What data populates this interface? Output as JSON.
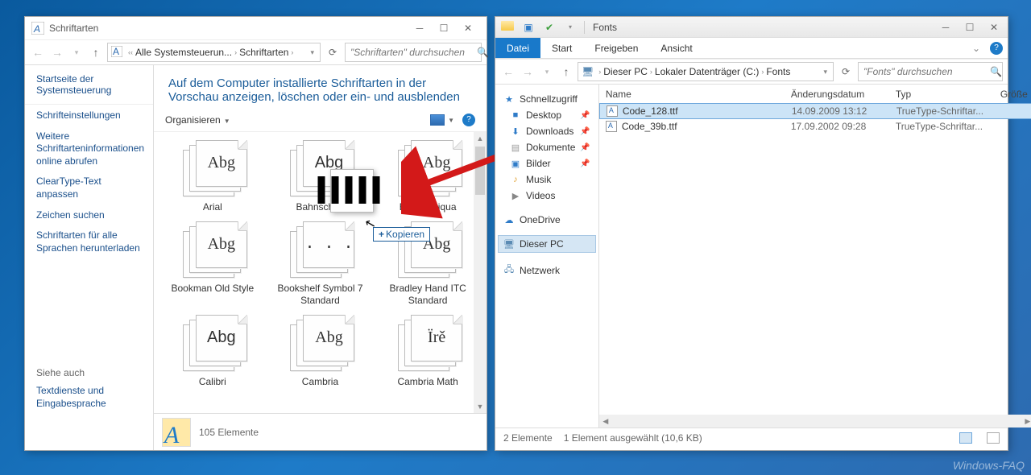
{
  "w1": {
    "title": "Schriftarten",
    "breadcrumb": {
      "seg1": "Alle Systemsteuerun...",
      "seg2": "Schriftarten"
    },
    "search_ph": "\"Schriftarten\" durchsuchen",
    "sidebar": {
      "header": "Startseite der Systemsteuerung",
      "links": [
        "Schrifteinstellungen",
        "Weitere Schriftarteninformationen online abrufen",
        "ClearType-Text anpassen",
        "Zeichen suchen",
        "Schriftarten für alle Sprachen herunterladen"
      ],
      "see_also": "Siehe auch",
      "see_link": "Textdienste und Eingabesprache"
    },
    "heading": "Auf dem Computer installierte Schriftarten in der Vorschau anzeigen, löschen oder ein- und ausblenden",
    "organize": "Organisieren",
    "fonts": [
      [
        "Arial",
        "Abg",
        "serif"
      ],
      [
        "Bahnschrift",
        "Abg",
        "sans"
      ],
      [
        "Book Antiqua",
        "Abg",
        "serif"
      ],
      [
        "Bookman Old Style",
        "Abg",
        "serif"
      ],
      [
        "Bookshelf Symbol 7 Standard",
        ". . .",
        "sym"
      ],
      [
        "Bradley Hand ITC Standard",
        "Abg",
        "cursive"
      ],
      [
        "Calibri",
        "Abg",
        "sans"
      ],
      [
        "Cambria",
        "Abg",
        "serif"
      ],
      [
        "Cambria Math",
        "Ïrě",
        "serif"
      ]
    ],
    "copy_tooltip": "Kopieren",
    "status": "105 Elemente"
  },
  "w2": {
    "title": "Fonts",
    "tabs": [
      "Datei",
      "Start",
      "Freigeben",
      "Ansicht"
    ],
    "breadcrumb": [
      "Dieser PC",
      "Lokaler Datenträger (C:)",
      "Fonts"
    ],
    "search_ph": "\"Fonts\" durchsuchen",
    "tree": {
      "quick": "Schnellzugriff",
      "items": [
        "Desktop",
        "Downloads",
        "Dokumente",
        "Bilder",
        "Musik",
        "Videos"
      ],
      "onedrive": "OneDrive",
      "thispc": "Dieser PC",
      "network": "Netzwerk"
    },
    "cols": [
      "Name",
      "Änderungsdatum",
      "Typ",
      "Größe"
    ],
    "files": [
      {
        "name": "Code_128.ttf",
        "date": "14.09.2009 13:12",
        "type": "TrueType-Schriftar...",
        "sel": true
      },
      {
        "name": "Code_39b.ttf",
        "date": "17.09.2002 09:28",
        "type": "TrueType-Schriftar...",
        "sel": false
      }
    ],
    "status_a": "2 Elemente",
    "status_b": "1 Element ausgewählt (10,6 KB)"
  },
  "watermark": "Windows-FAQ"
}
